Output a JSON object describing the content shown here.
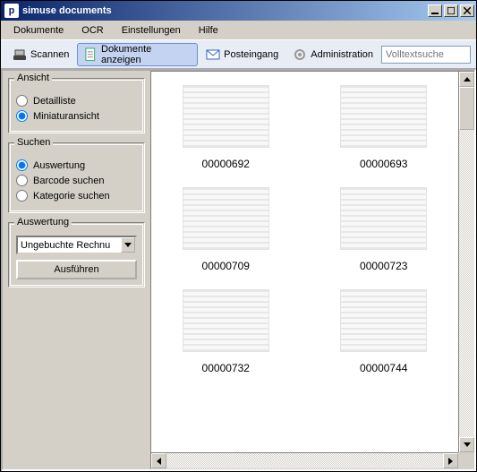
{
  "window": {
    "title": "simuse documents"
  },
  "menubar": [
    "Dokumente",
    "OCR",
    "Einstellungen",
    "Hilfe"
  ],
  "toolbar": {
    "scan": "Scannen",
    "show_docs": "Dokumente anzeigen",
    "inbox": "Posteingang",
    "admin": "Administration"
  },
  "search": {
    "placeholder": "Volltextsuche"
  },
  "sidebar": {
    "view": {
      "legend": "Ansicht",
      "options": {
        "detail": "Detailliste",
        "thumb": "Miniaturansicht"
      }
    },
    "search": {
      "legend": "Suchen",
      "options": {
        "eval": "Auswertung",
        "barcode": "Barcode suchen",
        "category": "Kategorie suchen"
      }
    },
    "evaluation": {
      "legend": "Auswertung",
      "selected": "Ungebuchte Rechnu",
      "execute": "Ausführen"
    }
  },
  "thumbs": [
    {
      "label": "00000692"
    },
    {
      "label": "00000693"
    },
    {
      "label": "00000709"
    },
    {
      "label": "00000723"
    },
    {
      "label": "00000732"
    },
    {
      "label": "00000744"
    }
  ]
}
